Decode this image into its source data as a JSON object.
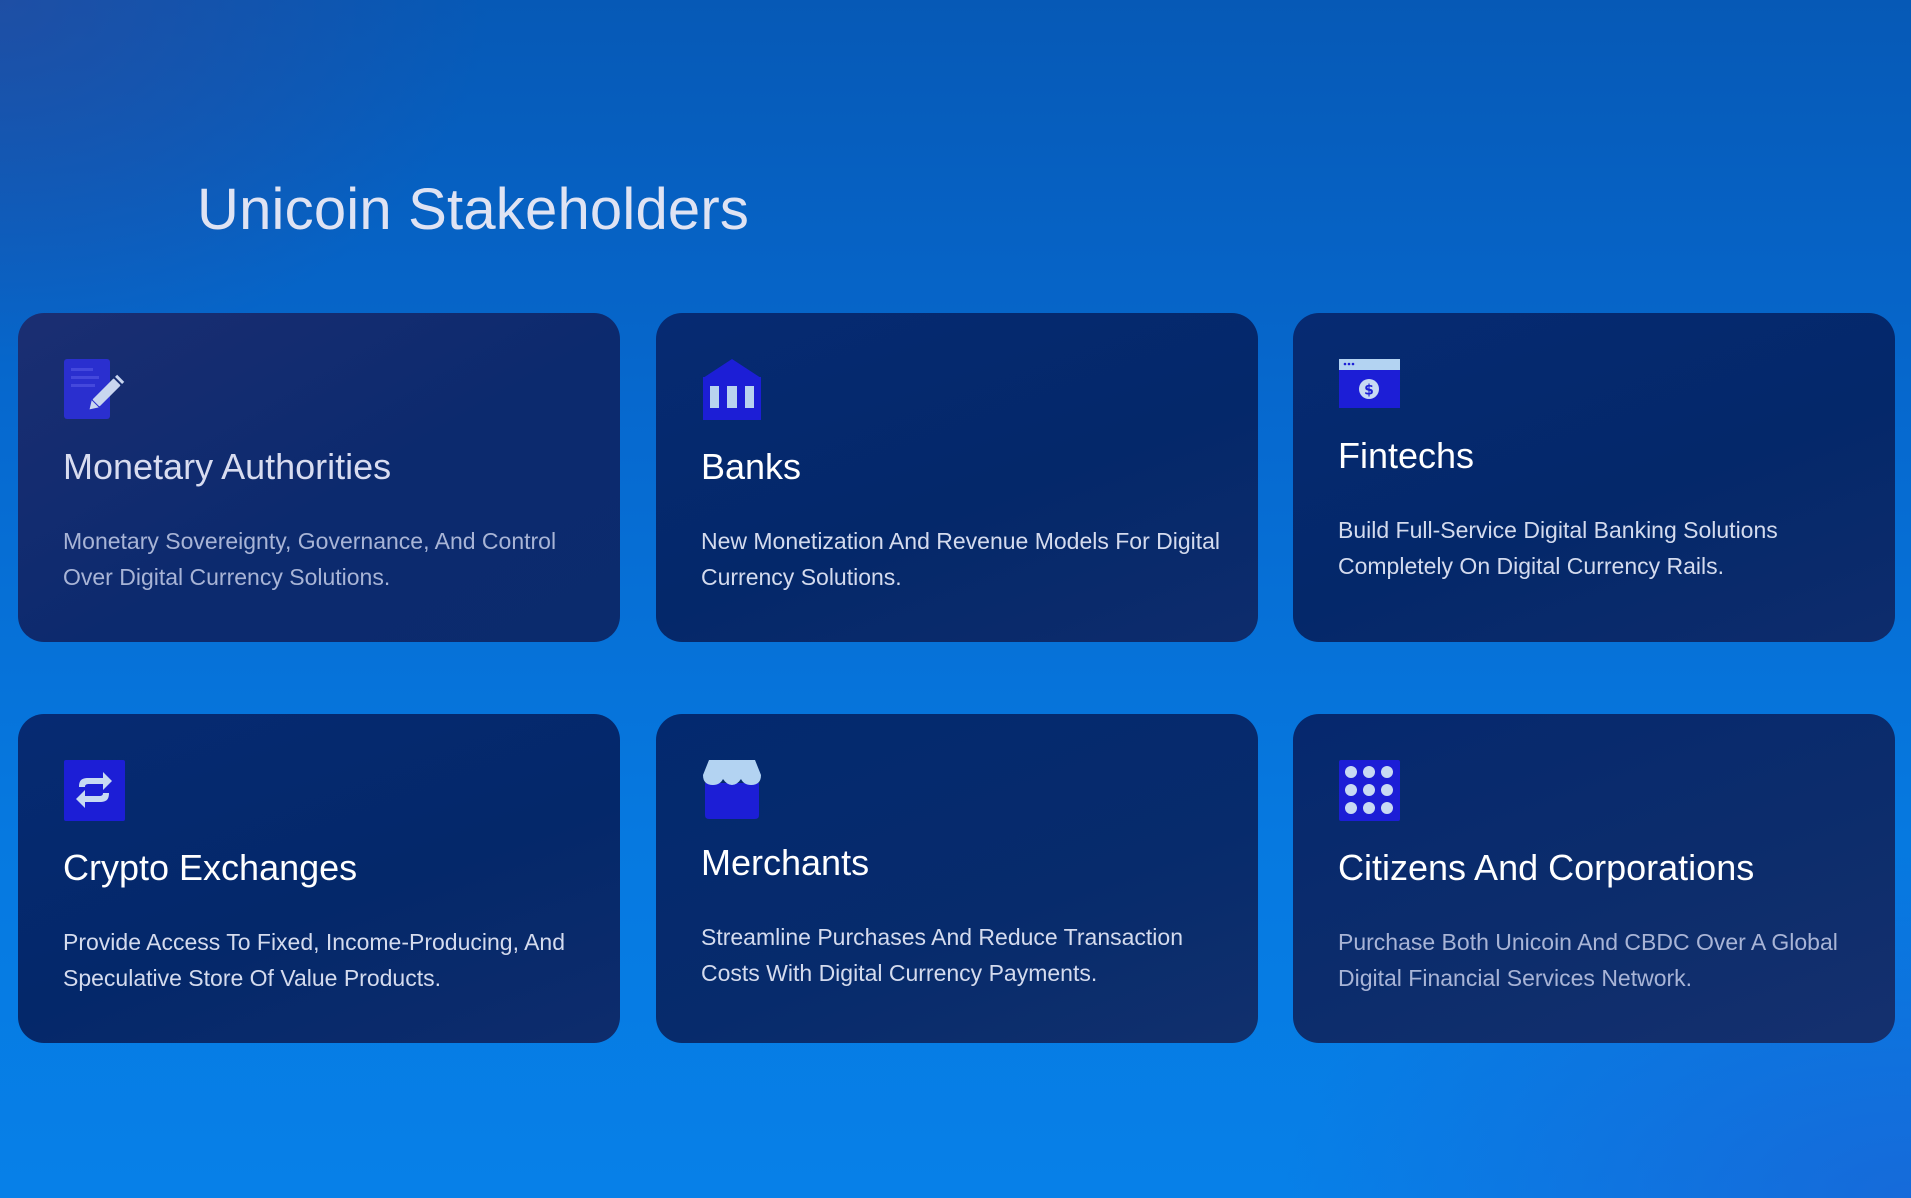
{
  "section": {
    "title": "Unicoin Stakeholders"
  },
  "colors": {
    "background_top": "#0659b6",
    "background_bottom": "#0780e8",
    "card_background": "#062a72",
    "icon_primary": "#1c1ed6",
    "icon_accent": "#b3d3f2",
    "text_white": "#ffffff",
    "text_muted": "#a8b4d6"
  },
  "cards": [
    {
      "icon": "document-edit-icon",
      "title": "Monetary Authorities",
      "description": "Monetary Sovereignty, Governance, And Control Over Digital Currency Solutions."
    },
    {
      "icon": "bank-icon",
      "title": "Banks",
      "description": "New Monetization And Revenue Models For Digital Currency Solutions."
    },
    {
      "icon": "payment-window-icon",
      "title": "Fintechs",
      "description": "Build Full-Service Digital Banking Solutions Completely On Digital Currency Rails."
    },
    {
      "icon": "exchange-arrows-icon",
      "title": "Crypto Exchanges",
      "description": "Provide Access To Fixed, Income-Producing, And Speculative Store Of Value Products."
    },
    {
      "icon": "storefront-icon",
      "title": "Merchants",
      "description": "Streamline Purchases And Reduce Transaction Costs With Digital Currency Payments."
    },
    {
      "icon": "dot-grid-icon",
      "title": "Citizens And Corporations",
      "description": "Purchase Both Unicoin And CBDC Over A Global Digital Financial Services Network."
    }
  ]
}
